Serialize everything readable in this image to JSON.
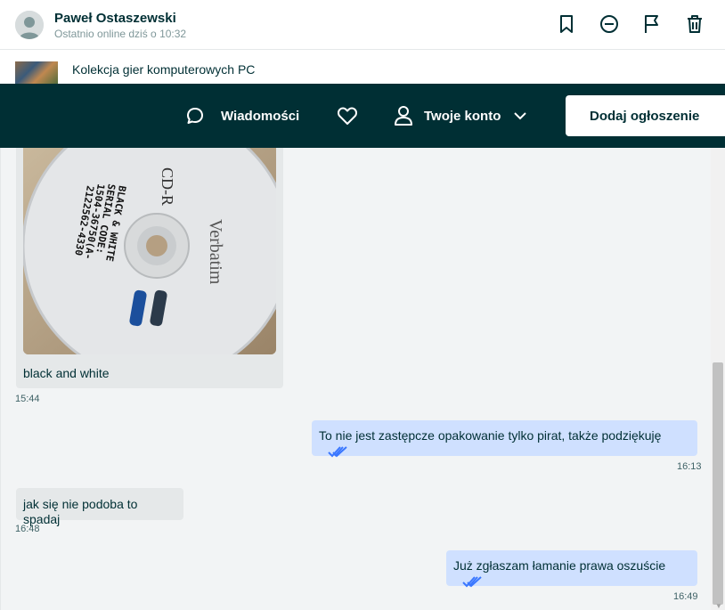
{
  "header": {
    "user_name": "Paweł Ostaszewski",
    "user_status": "Ostatnio online dziś o 10:32",
    "actions": [
      "bookmark-icon",
      "block-icon",
      "flag-icon",
      "trash-icon"
    ]
  },
  "ad": {
    "title": "Kolekcja gier komputerowych PC"
  },
  "nav": {
    "messages_label": "Wiadomości",
    "account_label": "Twoje konto",
    "post_ad_label": "Dodaj ogłoszenie"
  },
  "messages": [
    {
      "direction": "in",
      "type": "image",
      "caption": "black and white",
      "time": "15:44",
      "image_text": {
        "cd_label": "CD-R",
        "brand": "Verbatim",
        "handwriting": [
          "BLACK & WHITE",
          "SERIAL CODE:",
          "1504-36750(A-",
          "2122562-4330"
        ]
      }
    },
    {
      "direction": "out",
      "text": "To nie jest zastępcze opakowanie tylko pirat, także podziękuję",
      "time": "16:13"
    },
    {
      "direction": "in",
      "text": "jak się nie podoba to spadaj",
      "time": "16:48"
    },
    {
      "direction": "out",
      "text": "Już zgłaszam łamanie prawa oszuście",
      "time": "16:49"
    }
  ],
  "colors": {
    "nav_bg": "#002f34",
    "outgoing_bubble": "#cfe0ff",
    "incoming_bubble": "#e5e8e9",
    "read_ticks": "#3a77ff"
  }
}
